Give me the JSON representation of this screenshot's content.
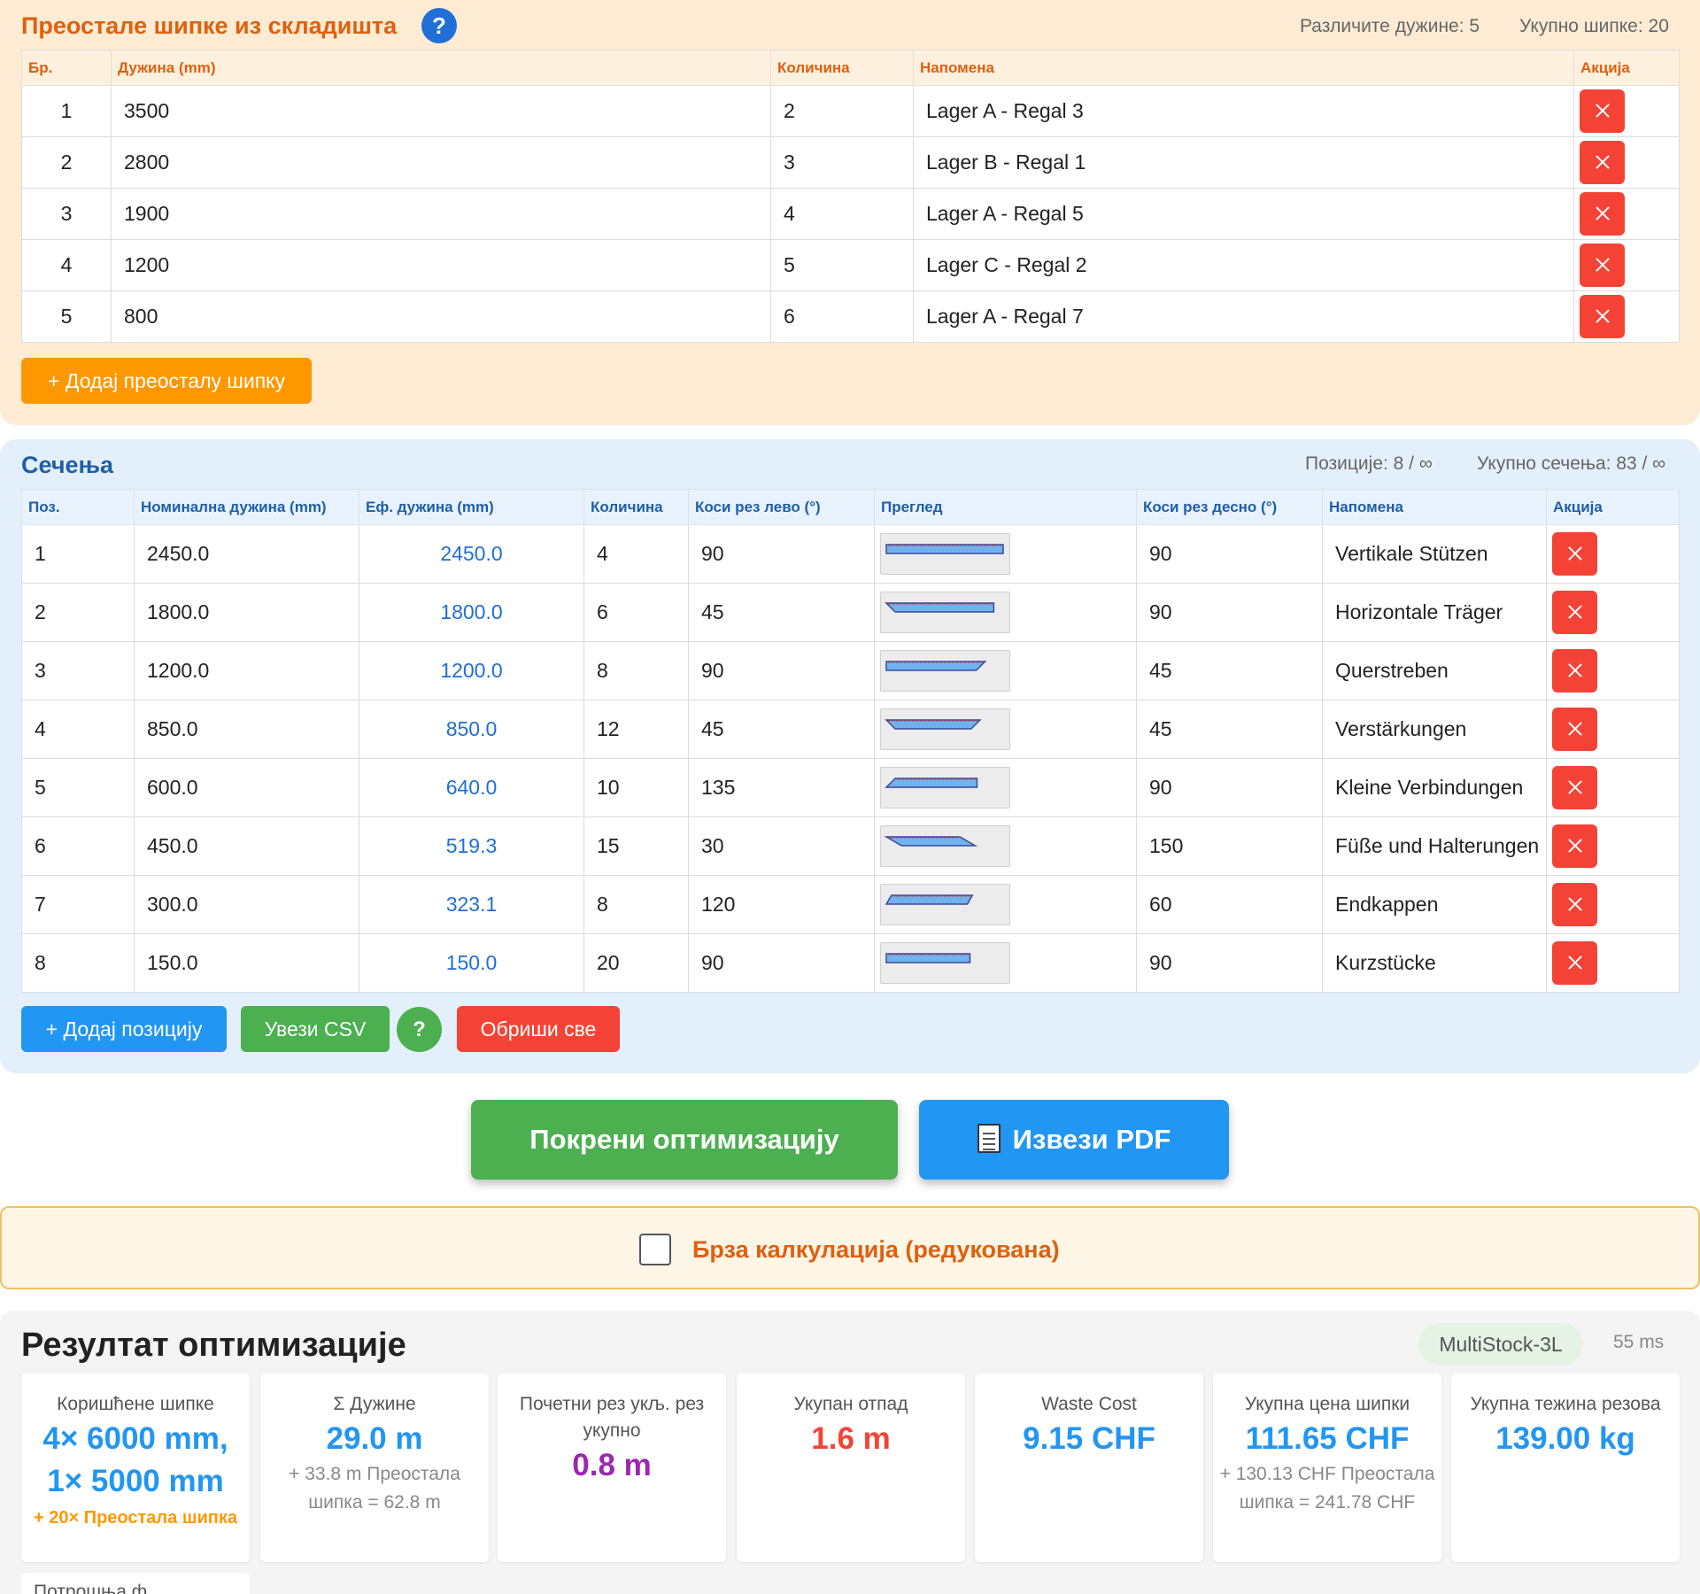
{
  "stock": {
    "title": "Преостале шипке из складишта",
    "stat_lengths": "Различите дужине: 5",
    "stat_total": "Укупно шипке: 20",
    "columns": [
      "Бр.",
      "Дужина (mm)",
      "Количина",
      "Напомена",
      "Акција"
    ],
    "rows": [
      {
        "no": "1",
        "length": "3500",
        "qty": "2",
        "note": "Lager A - Regal 3"
      },
      {
        "no": "2",
        "length": "2800",
        "qty": "3",
        "note": "Lager B - Regal 1"
      },
      {
        "no": "3",
        "length": "1900",
        "qty": "4",
        "note": "Lager A - Regal 5"
      },
      {
        "no": "4",
        "length": "1200",
        "qty": "5",
        "note": "Lager C - Regal 2"
      },
      {
        "no": "5",
        "length": "800",
        "qty": "6",
        "note": "Lager A - Regal 7"
      }
    ],
    "add_label": "+ Додај преосталу шипку"
  },
  "cuts": {
    "title": "Сечења",
    "stat_positions": "Позиције: 8 / ∞",
    "stat_total": "Укупно сечења: 83 / ∞",
    "columns": [
      "Поз.",
      "Номинална дужина (mm)",
      "Еф. дужина (mm)",
      "Количина",
      "Коси рез лево (°)",
      "Преглед",
      "Коси рез десно (°)",
      "Напомена",
      "Акција"
    ],
    "rows": [
      {
        "pos": "1",
        "nominal": "2450.0",
        "effective": "2450.0",
        "qty": "4",
        "left": "90",
        "right": "90",
        "note": "Vertikale Stützen"
      },
      {
        "pos": "2",
        "nominal": "1800.0",
        "effective": "1800.0",
        "qty": "6",
        "left": "45",
        "right": "90",
        "note": "Horizontale Träger"
      },
      {
        "pos": "3",
        "nominal": "1200.0",
        "effective": "1200.0",
        "qty": "8",
        "left": "90",
        "right": "45",
        "note": "Querstreben"
      },
      {
        "pos": "4",
        "nominal": "850.0",
        "effective": "850.0",
        "qty": "12",
        "left": "45",
        "right": "45",
        "note": "Verstärkungen"
      },
      {
        "pos": "5",
        "nominal": "600.0",
        "effective": "640.0",
        "qty": "10",
        "left": "135",
        "right": "90",
        "note": "Kleine Verbindungen"
      },
      {
        "pos": "6",
        "nominal": "450.0",
        "effective": "519.3",
        "qty": "15",
        "left": "30",
        "right": "150",
        "note": "Füße und Halterungen"
      },
      {
        "pos": "7",
        "nominal": "300.0",
        "effective": "323.1",
        "qty": "8",
        "left": "120",
        "right": "60",
        "note": "Endkappen"
      },
      {
        "pos": "8",
        "nominal": "150.0",
        "effective": "150.0",
        "qty": "20",
        "left": "90",
        "right": "90",
        "note": "Kurzstücke"
      }
    ],
    "add_label": "+ Додај позицију",
    "import_label": "Увези CSV",
    "help_label": "?",
    "delete_all_label": "Обриши све"
  },
  "actions": {
    "run_label": "Покрени оптимизацију",
    "pdf_label": "Извези PDF"
  },
  "quick": {
    "label": "Брза калкулација (редукована)",
    "checked": false
  },
  "results": {
    "title": "Резултат оптимизације",
    "algorithm": "MultiStock-3L",
    "time": "55 ms",
    "cards": [
      {
        "label": "Коришћене шипке",
        "value_line1": "4× 6000 mm,",
        "value_line2": "1× 5000 mm",
        "extra": "+ 20× Преостала шипка"
      },
      {
        "label": "Σ Дужине",
        "value": "29.0 m",
        "sub": "+ 33.8 m Преостала шипка = 62.8 m"
      },
      {
        "label": "Почетни рез укљ. рез укупно",
        "value": "0.8 m"
      },
      {
        "label": "Укупан отпад",
        "value": "1.6 m"
      },
      {
        "label": "Waste Cost",
        "value": "9.15 CHF"
      },
      {
        "label": "Укупна цена шипки",
        "value": "111.65 CHF",
        "sub": "+ 130.13 CHF Преостала шипка = 241.78 CHF"
      },
      {
        "label": "Укупна тежина резова",
        "value": "139.00 kg"
      }
    ],
    "next_label": "Потрошња ф"
  },
  "colors": {
    "stock_accent": "#e0600e",
    "cuts_accent": "#1f5fa8",
    "primary_blue": "#2196f3",
    "green": "#4caf50",
    "red": "#f44336",
    "orange": "#ff9800",
    "purple": "#9c27b0"
  },
  "icons": {
    "stock_help": "help-circle-icon",
    "delete": "close-icon",
    "pdf": "document-icon"
  }
}
